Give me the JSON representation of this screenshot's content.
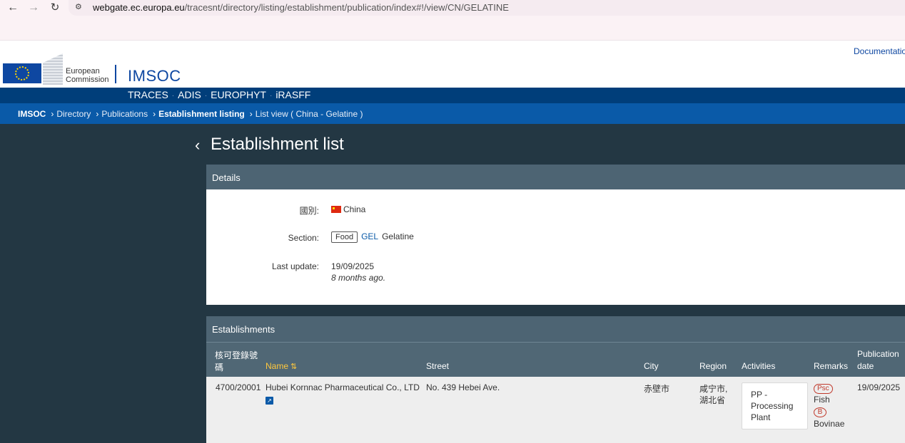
{
  "browser": {
    "back_icon": "arrow-left-icon",
    "forward_icon": "arrow-right-icon",
    "reload_icon": "reload-icon",
    "url_host": "webgate.ec.europa.eu",
    "url_path": "/tracesnt/directory/listing/establishment/publication/index#!/view/CN/GELATINE"
  },
  "header": {
    "org_line1": "European",
    "org_line2": "Commission",
    "app_name": "IMSOC",
    "documentation_link": "Documentatio"
  },
  "apps": [
    "TRACES",
    "ADIS",
    "EUROPHYT",
    "iRASFF"
  ],
  "breadcrumb": {
    "root": "IMSOC",
    "items": [
      "Directory",
      "Publications",
      "Establishment listing",
      "List view ( China - Gelatine )"
    ]
  },
  "page": {
    "title": "Establishment list"
  },
  "details": {
    "heading": "Details",
    "country_label": "國別:",
    "country_value": "China",
    "section_label": "Section:",
    "section_tag": "Food",
    "section_code": "GEL",
    "section_name": "Gelatine",
    "last_update_label": "Last update:",
    "last_update_date": "19/09/2025",
    "last_update_ago": "8 months ago."
  },
  "establishments": {
    "heading": "Establishments",
    "columns": {
      "approval_line1": "核可登錄號",
      "approval_line2": "碼",
      "name": "Name",
      "street": "Street",
      "city": "City",
      "region": "Region",
      "activities": "Activities",
      "remarks": "Remarks",
      "pubdate_line1": "Publication",
      "pubdate_line2": "date"
    },
    "rows": [
      {
        "approval_number": "4700/20001",
        "name": "Hubei Kornnac Pharmaceutical Co., LTD",
        "street": "No. 439 Hebei Ave.",
        "city": "赤壁市",
        "region_line1": "咸宁市,",
        "region_line2": "湖北省",
        "activity_line1": "PP -",
        "activity_line2": "Processing",
        "activity_line3": "Plant",
        "remark1_badge": "Psc",
        "remark1_text": "Fish",
        "remark2_badge": "B",
        "remark2_text": "Bovinae",
        "publication_date": "19/09/2025"
      }
    ]
  },
  "colors": {
    "page_bg": "#233743",
    "panel_head": "#4d6473",
    "apps_bar": "#003e7a",
    "breadcrumb_bar": "#0a5aa8",
    "brand_blue": "#0e47a1",
    "sort_accent": "#ffc83d",
    "remark_red": "#c0392b"
  }
}
